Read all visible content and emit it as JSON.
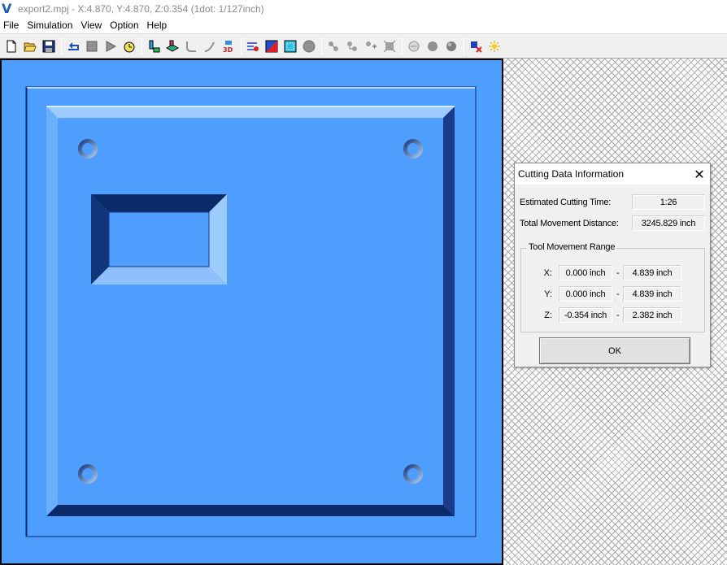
{
  "window": {
    "title": "export2.mpj - X:4.870, Y:4.870, Z:0.354 (1dot: 1/127inch)",
    "logo_glyph": "V"
  },
  "menu": [
    "File",
    "Simulation",
    "View",
    "Option",
    "Help"
  ],
  "toolbar": {
    "groups": [
      [
        "new-icon",
        "open-icon",
        "save-icon"
      ],
      [
        "rewind-icon",
        "stop-icon",
        "play-icon",
        "step-icon"
      ],
      [
        "tool-icon",
        "workpiece-icon",
        "path-curve-icon",
        "path-line-icon",
        "view-3d-icon"
      ],
      [
        "cutting-data-icon",
        "color-icon",
        "fit-view-icon",
        "sphere-icon"
      ],
      [
        "view-top-icon",
        "view-front-icon",
        "view-side-icon",
        "view-zoom-icon"
      ],
      [
        "shade-light-icon",
        "shade-dark-icon",
        "shade-solid-icon"
      ],
      [
        "settings-icon",
        "light-icon"
      ]
    ]
  },
  "colors": {
    "part_blue": "#4d9eff",
    "shadow_dark": "#0a2a6a",
    "highlight": "#b8d8ff"
  },
  "dialog": {
    "title": "Cutting Data Information",
    "close_glyph": "✕",
    "estimated_time_label": "Estimated Cutting Time:",
    "estimated_time_value": "1:26",
    "total_distance_label": "Total Movement Distance:",
    "total_distance_value": "3245.829 inch",
    "range_group_title": "Tool Movement Range",
    "range": [
      {
        "axis": "X:",
        "min": "0.000 inch",
        "max": "4.839 inch"
      },
      {
        "axis": "Y:",
        "min": "0.000 inch",
        "max": "4.839 inch"
      },
      {
        "axis": "Z:",
        "min": "-0.354 inch",
        "max": "2.382 inch"
      }
    ],
    "range_separator": "-",
    "ok_label": "OK"
  }
}
